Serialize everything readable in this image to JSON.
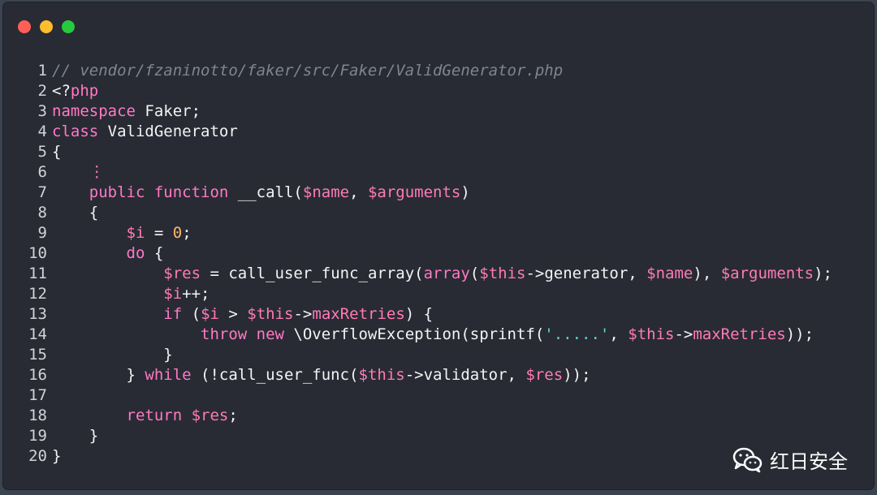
{
  "window": {
    "controls": [
      "close",
      "minimize",
      "maximize"
    ]
  },
  "code": {
    "lines": [
      {
        "n": "1",
        "segs": [
          {
            "t": "// vendor/fzaninotto/faker/src/Faker/ValidGenerator.php",
            "c": "cm"
          }
        ]
      },
      {
        "n": "2",
        "segs": [
          {
            "t": "<?",
            "c": "fn"
          },
          {
            "t": "php",
            "c": "kw"
          }
        ]
      },
      {
        "n": "3",
        "segs": [
          {
            "t": "namespace",
            "c": "kw"
          },
          {
            "t": " Faker;",
            "c": "fn"
          }
        ]
      },
      {
        "n": "4",
        "segs": [
          {
            "t": "class",
            "c": "kw"
          },
          {
            "t": " ValidGenerator",
            "c": "fn"
          }
        ]
      },
      {
        "n": "5",
        "segs": [
          {
            "t": "{",
            "c": "fn"
          }
        ]
      },
      {
        "n": "6",
        "segs": [
          {
            "t": "    ",
            "c": "fn"
          },
          {
            "t": "⋮",
            "c": "kw"
          }
        ]
      },
      {
        "n": "7",
        "segs": [
          {
            "t": "    ",
            "c": "fn"
          },
          {
            "t": "public function",
            "c": "kw"
          },
          {
            "t": " __call(",
            "c": "fn"
          },
          {
            "t": "$name",
            "c": "vr"
          },
          {
            "t": ", ",
            "c": "fn"
          },
          {
            "t": "$arguments",
            "c": "vr"
          },
          {
            "t": ")",
            "c": "fn"
          }
        ]
      },
      {
        "n": "8",
        "segs": [
          {
            "t": "    {",
            "c": "fn"
          }
        ]
      },
      {
        "n": "9",
        "segs": [
          {
            "t": "        ",
            "c": "fn"
          },
          {
            "t": "$i",
            "c": "vr"
          },
          {
            "t": " = ",
            "c": "fn"
          },
          {
            "t": "0",
            "c": "nm"
          },
          {
            "t": ";",
            "c": "fn"
          }
        ]
      },
      {
        "n": "10",
        "segs": [
          {
            "t": "        ",
            "c": "fn"
          },
          {
            "t": "do",
            "c": "kw"
          },
          {
            "t": " {",
            "c": "fn"
          }
        ]
      },
      {
        "n": "11",
        "segs": [
          {
            "t": "            ",
            "c": "fn"
          },
          {
            "t": "$res",
            "c": "vr"
          },
          {
            "t": " = call_user_func_array(",
            "c": "fn"
          },
          {
            "t": "array",
            "c": "kw"
          },
          {
            "t": "(",
            "c": "fn"
          },
          {
            "t": "$this",
            "c": "vr"
          },
          {
            "t": "->generator, ",
            "c": "fn"
          },
          {
            "t": "$name",
            "c": "vr"
          },
          {
            "t": "), ",
            "c": "fn"
          },
          {
            "t": "$arguments",
            "c": "vr"
          },
          {
            "t": ");",
            "c": "fn"
          }
        ]
      },
      {
        "n": "12",
        "segs": [
          {
            "t": "            ",
            "c": "fn"
          },
          {
            "t": "$i",
            "c": "vr"
          },
          {
            "t": "++;",
            "c": "fn"
          }
        ]
      },
      {
        "n": "13",
        "segs": [
          {
            "t": "            ",
            "c": "fn"
          },
          {
            "t": "if",
            "c": "kw"
          },
          {
            "t": " (",
            "c": "fn"
          },
          {
            "t": "$i",
            "c": "vr"
          },
          {
            "t": " > ",
            "c": "fn"
          },
          {
            "t": "$this",
            "c": "vr"
          },
          {
            "t": "->",
            "c": "fn"
          },
          {
            "t": "maxRetries",
            "c": "vr"
          },
          {
            "t": ") {",
            "c": "fn"
          }
        ]
      },
      {
        "n": "14",
        "segs": [
          {
            "t": "                ",
            "c": "fn"
          },
          {
            "t": "throw new",
            "c": "kw"
          },
          {
            "t": " \\OverflowException(sprintf(",
            "c": "fn"
          },
          {
            "t": "'.....'",
            "c": "st"
          },
          {
            "t": ", ",
            "c": "fn"
          },
          {
            "t": "$this",
            "c": "vr"
          },
          {
            "t": "->",
            "c": "fn"
          },
          {
            "t": "maxRetries",
            "c": "vr"
          },
          {
            "t": "));",
            "c": "fn"
          }
        ]
      },
      {
        "n": "15",
        "segs": [
          {
            "t": "            }",
            "c": "fn"
          }
        ]
      },
      {
        "n": "16",
        "segs": [
          {
            "t": "        } ",
            "c": "fn"
          },
          {
            "t": "while",
            "c": "kw"
          },
          {
            "t": " (!call_user_func(",
            "c": "fn"
          },
          {
            "t": "$this",
            "c": "vr"
          },
          {
            "t": "->validator, ",
            "c": "fn"
          },
          {
            "t": "$res",
            "c": "vr"
          },
          {
            "t": "));",
            "c": "fn"
          }
        ]
      },
      {
        "n": "17",
        "segs": [
          {
            "t": "",
            "c": "fn"
          }
        ]
      },
      {
        "n": "18",
        "segs": [
          {
            "t": "        ",
            "c": "fn"
          },
          {
            "t": "return",
            "c": "kw"
          },
          {
            "t": " ",
            "c": "fn"
          },
          {
            "t": "$res",
            "c": "vr"
          },
          {
            "t": ";",
            "c": "fn"
          }
        ]
      },
      {
        "n": "19",
        "segs": [
          {
            "t": "    }",
            "c": "fn"
          }
        ]
      },
      {
        "n": "20",
        "segs": [
          {
            "t": "}",
            "c": "fn"
          }
        ]
      }
    ]
  },
  "watermark": {
    "icon": "wechat-icon",
    "text": "红日安全"
  }
}
